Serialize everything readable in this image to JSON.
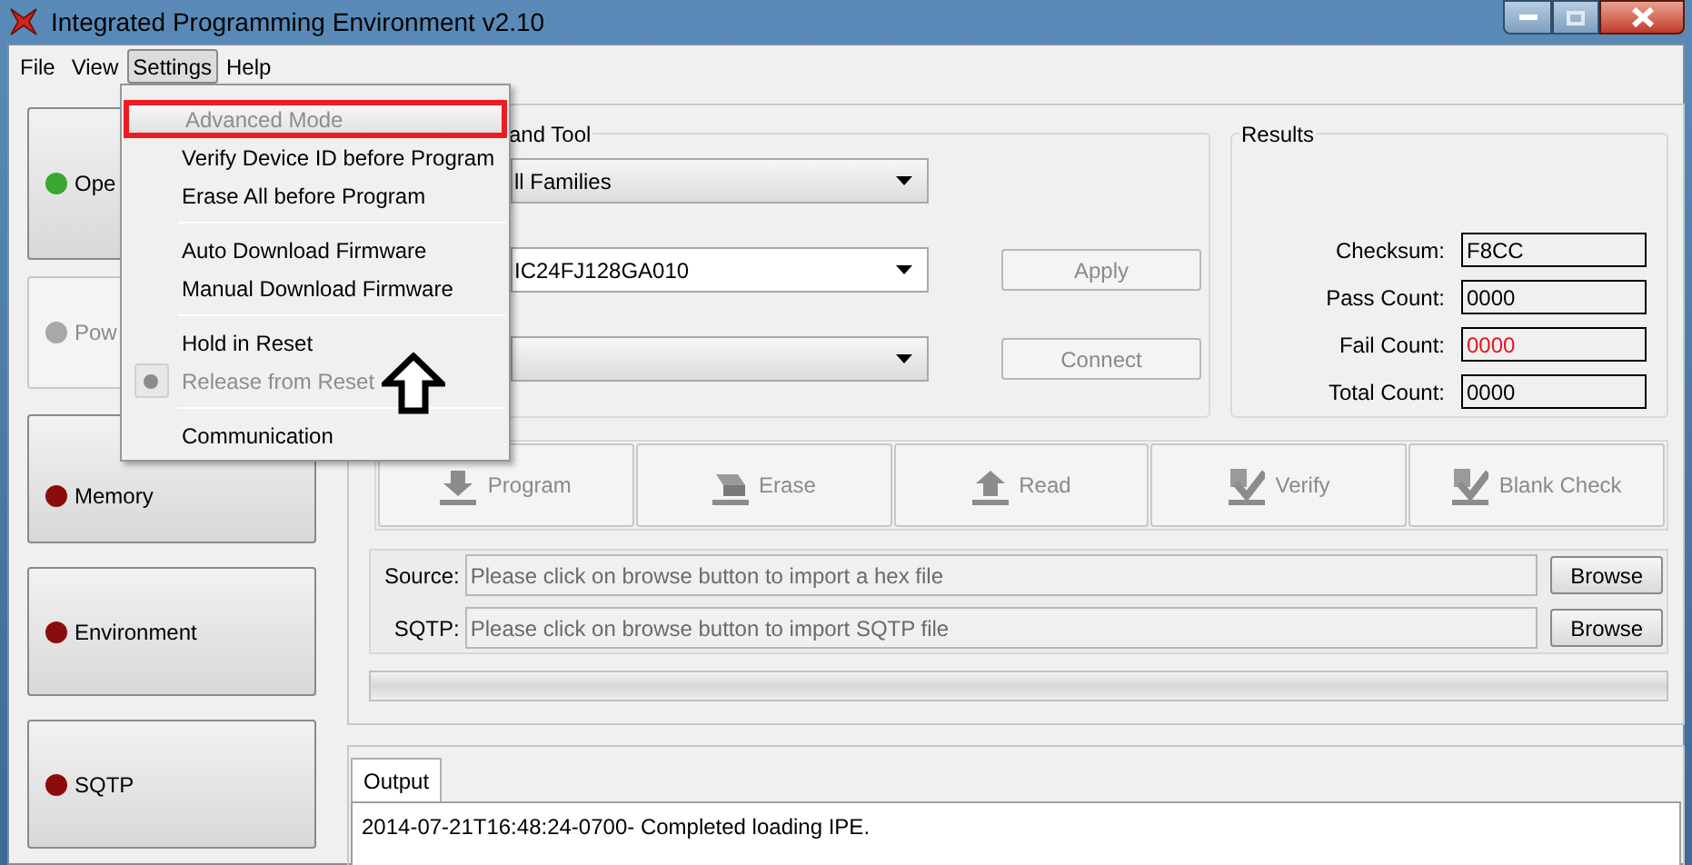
{
  "window": {
    "title": "Integrated Programming Environment v2.10"
  },
  "menubar": [
    {
      "label": "File",
      "selected": false
    },
    {
      "label": "View",
      "selected": false
    },
    {
      "label": "Settings",
      "selected": true
    },
    {
      "label": "Help",
      "selected": false
    }
  ],
  "settings_menu": [
    {
      "kind": "item",
      "label": "Advanced Mode",
      "disabled": true,
      "annotated": true,
      "radio": false
    },
    {
      "kind": "item",
      "label": "Verify Device ID before Program",
      "disabled": false,
      "annotated": false,
      "radio": false
    },
    {
      "kind": "item",
      "label": "Erase All before Program",
      "disabled": false,
      "annotated": false,
      "radio": false
    },
    {
      "kind": "separator"
    },
    {
      "kind": "item",
      "label": "Auto Download Firmware",
      "disabled": false,
      "annotated": false,
      "radio": false
    },
    {
      "kind": "item",
      "label": "Manual Download Firmware",
      "disabled": false,
      "annotated": false,
      "radio": false
    },
    {
      "kind": "separator"
    },
    {
      "kind": "item",
      "label": "Hold in Reset",
      "disabled": false,
      "annotated": false,
      "radio": false
    },
    {
      "kind": "item",
      "label": "Release from Reset",
      "disabled": true,
      "annotated": false,
      "radio": true
    },
    {
      "kind": "separator"
    },
    {
      "kind": "item",
      "label": "Communication",
      "disabled": false,
      "annotated": false,
      "radio": false
    }
  ],
  "sidebar": [
    {
      "label": "Ope",
      "color": "#3aa832",
      "disabled": false
    },
    {
      "label": "Pow",
      "color": "#a8a8a8",
      "disabled": true
    },
    {
      "label": "Memory",
      "color": "#8b0c0c",
      "disabled": false
    },
    {
      "label": "Environment",
      "color": "#8b0c0c",
      "disabled": false
    },
    {
      "label": "SQTP",
      "color": "#8b0c0c",
      "disabled": false
    }
  ],
  "device_group": {
    "title": "and Tool",
    "family": "ll Families",
    "device": "IC24FJ128GA010",
    "apply": "Apply",
    "connect": "Connect"
  },
  "results": {
    "title": "Results",
    "rows": [
      {
        "label": "Checksum:",
        "value": "F8CC",
        "alert": false
      },
      {
        "label": "Pass Count:",
        "value": "0000",
        "alert": false
      },
      {
        "label": "Fail Count:",
        "value": "0000",
        "alert": true
      },
      {
        "label": "Total Count:",
        "value": "0000",
        "alert": false
      }
    ]
  },
  "operations": [
    {
      "label": "Program",
      "kind": "down"
    },
    {
      "label": "Erase",
      "kind": "erase"
    },
    {
      "label": "Read",
      "kind": "up"
    },
    {
      "label": "Verify",
      "kind": "check"
    },
    {
      "label": "Blank Check",
      "kind": "check"
    }
  ],
  "files": [
    {
      "label": "Source:",
      "placeholder": "Please click on browse button to import a hex file",
      "button": "Browse"
    },
    {
      "label": "SQTP:",
      "placeholder": "Please click on browse button to import SQTP file",
      "button": "Browse"
    }
  ],
  "progress": {
    "level": 0
  },
  "output": {
    "tab": "Output",
    "lines": [
      "2014-07-21T16:48:24-0700- Completed loading IPE."
    ]
  }
}
